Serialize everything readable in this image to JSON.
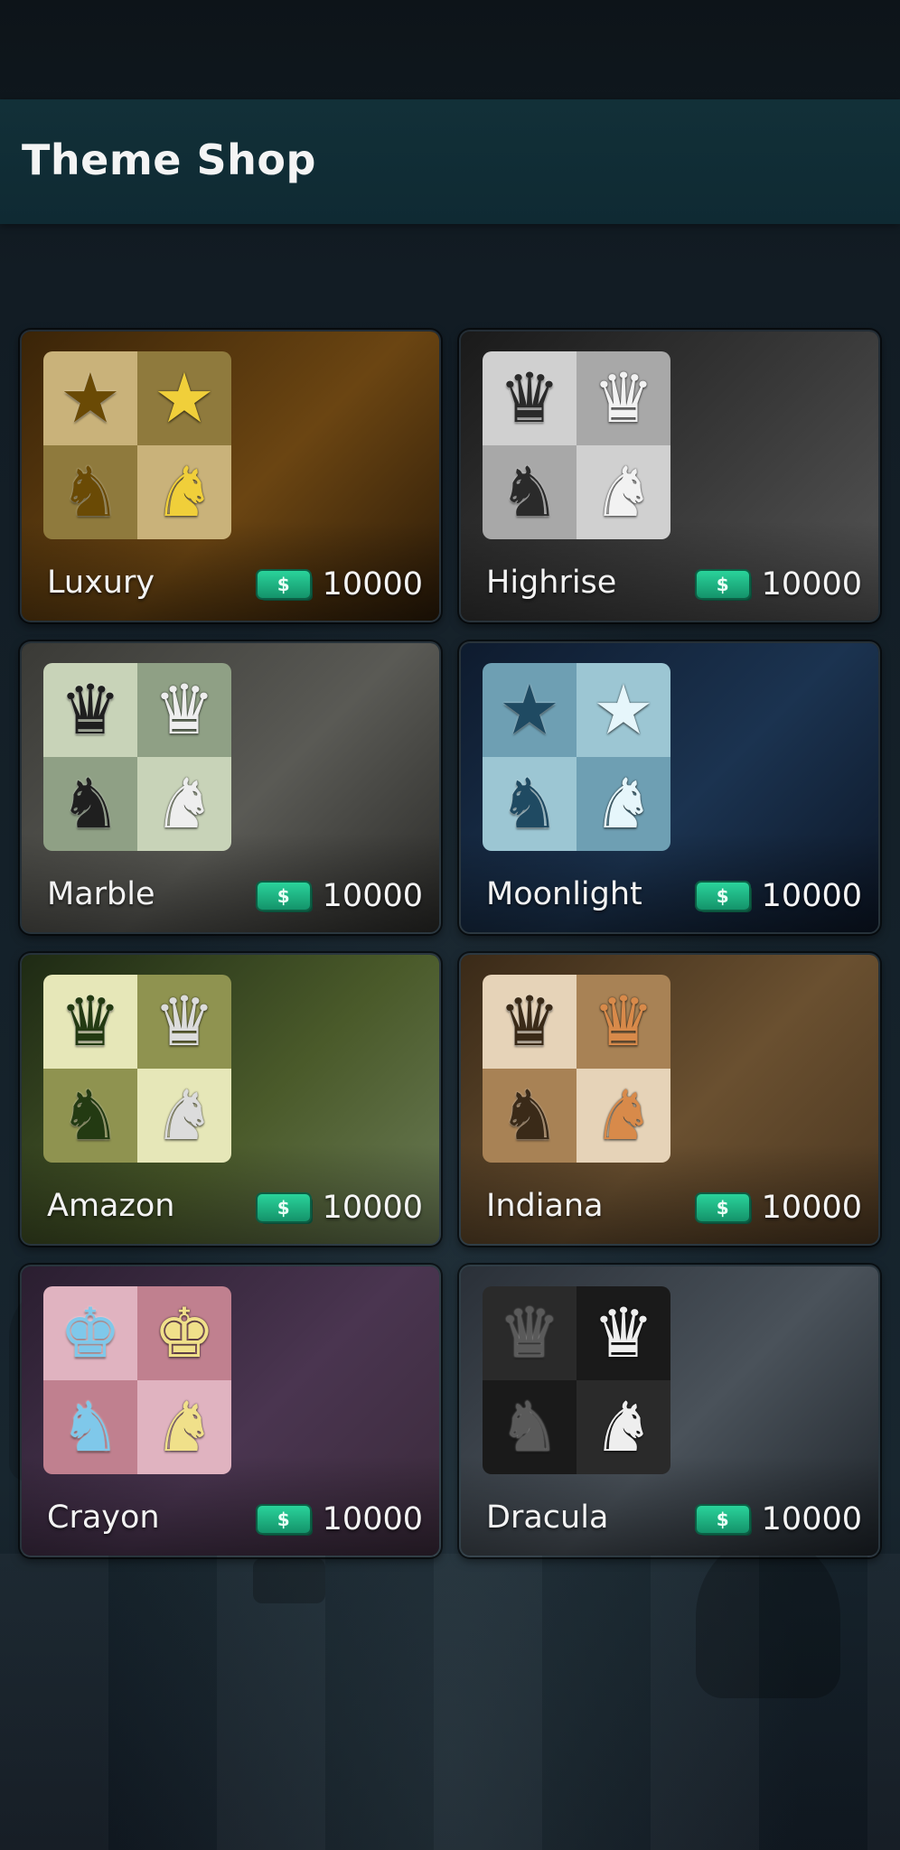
{
  "header": {
    "title": "Theme Shop"
  },
  "currency_icon_text": "$",
  "themes": [
    {
      "name": "Luxury",
      "price": "10000",
      "bg": [
        "#3a2408",
        "#6b4512",
        "#2a1a08"
      ],
      "cells": [
        "#c9b27a",
        "#8f7a3d",
        "#8f7a3d",
        "#c9b27a"
      ],
      "dark_piece_color": "#6a4a05",
      "light_piece_color": "#f0cf3a",
      "queen_glyph": "★",
      "knight_glyph": "♞"
    },
    {
      "name": "Highrise",
      "price": "10000",
      "bg": [
        "#1a1a1a",
        "#3a3a3a",
        "#555555"
      ],
      "cells": [
        "#d0d0d0",
        "#a8a8a8",
        "#a8a8a8",
        "#d0d0d0"
      ],
      "dark_piece_color": "#2a2a2a",
      "light_piece_color": "#f2f2f2",
      "queen_glyph": "♛",
      "knight_glyph": "♞"
    },
    {
      "name": "Marble",
      "price": "10000",
      "bg": [
        "#3a3a36",
        "#5a5a55",
        "#2a2a28"
      ],
      "cells": [
        "#c8d3b8",
        "#8fa085",
        "#8fa085",
        "#c8d3b8"
      ],
      "dark_piece_color": "#1f1f1f",
      "light_piece_color": "#eeeeee",
      "queen_glyph": "♛",
      "knight_glyph": "♞"
    },
    {
      "name": "Moonlight",
      "price": "10000",
      "bg": [
        "#0e1b2e",
        "#1b3350",
        "#0c1626"
      ],
      "cells": [
        "#6e9fb3",
        "#9cc6d3",
        "#9cc6d3",
        "#6e9fb3"
      ],
      "dark_piece_color": "#1f4a62",
      "light_piece_color": "#e6f6fb",
      "queen_glyph": "★",
      "knight_glyph": "♞"
    },
    {
      "name": "Amazon",
      "price": "10000",
      "bg": [
        "#1e2a14",
        "#4a5a2a",
        "#6a7a55"
      ],
      "cells": [
        "#e6e7b8",
        "#8f9350",
        "#8f9350",
        "#e6e7b8"
      ],
      "dark_piece_color": "#233a12",
      "light_piece_color": "#dcdcdc",
      "queen_glyph": "♛",
      "knight_glyph": "♞"
    },
    {
      "name": "Indiana",
      "price": "10000",
      "bg": [
        "#3a2a18",
        "#6a5030",
        "#4a3620"
      ],
      "cells": [
        "#e6d3b8",
        "#a88255",
        "#a88255",
        "#e6d3b8"
      ],
      "dark_piece_color": "#3a2a18",
      "light_piece_color": "#d88a4a",
      "queen_glyph": "♛",
      "knight_glyph": "♞"
    },
    {
      "name": "Crayon",
      "price": "10000",
      "bg": [
        "#2a1e30",
        "#4a3550",
        "#3a2a3a"
      ],
      "cells": [
        "#e0b3c0",
        "#c0808f",
        "#c0808f",
        "#e0b3c0"
      ],
      "dark_piece_color": "#7fc8ea",
      "light_piece_color": "#f0e08a",
      "queen_glyph": "♚",
      "knight_glyph": "♞"
    },
    {
      "name": "Dracula",
      "price": "10000",
      "bg": [
        "#2a3038",
        "#4a525a",
        "#1e242a"
      ],
      "cells": [
        "#2a2a2a",
        "#1a1a1a",
        "#1a1a1a",
        "#2a2a2a"
      ],
      "dark_piece_color": "#5a5a5a",
      "light_piece_color": "#eeeeee",
      "queen_glyph": "♛",
      "knight_glyph": "♞"
    }
  ]
}
